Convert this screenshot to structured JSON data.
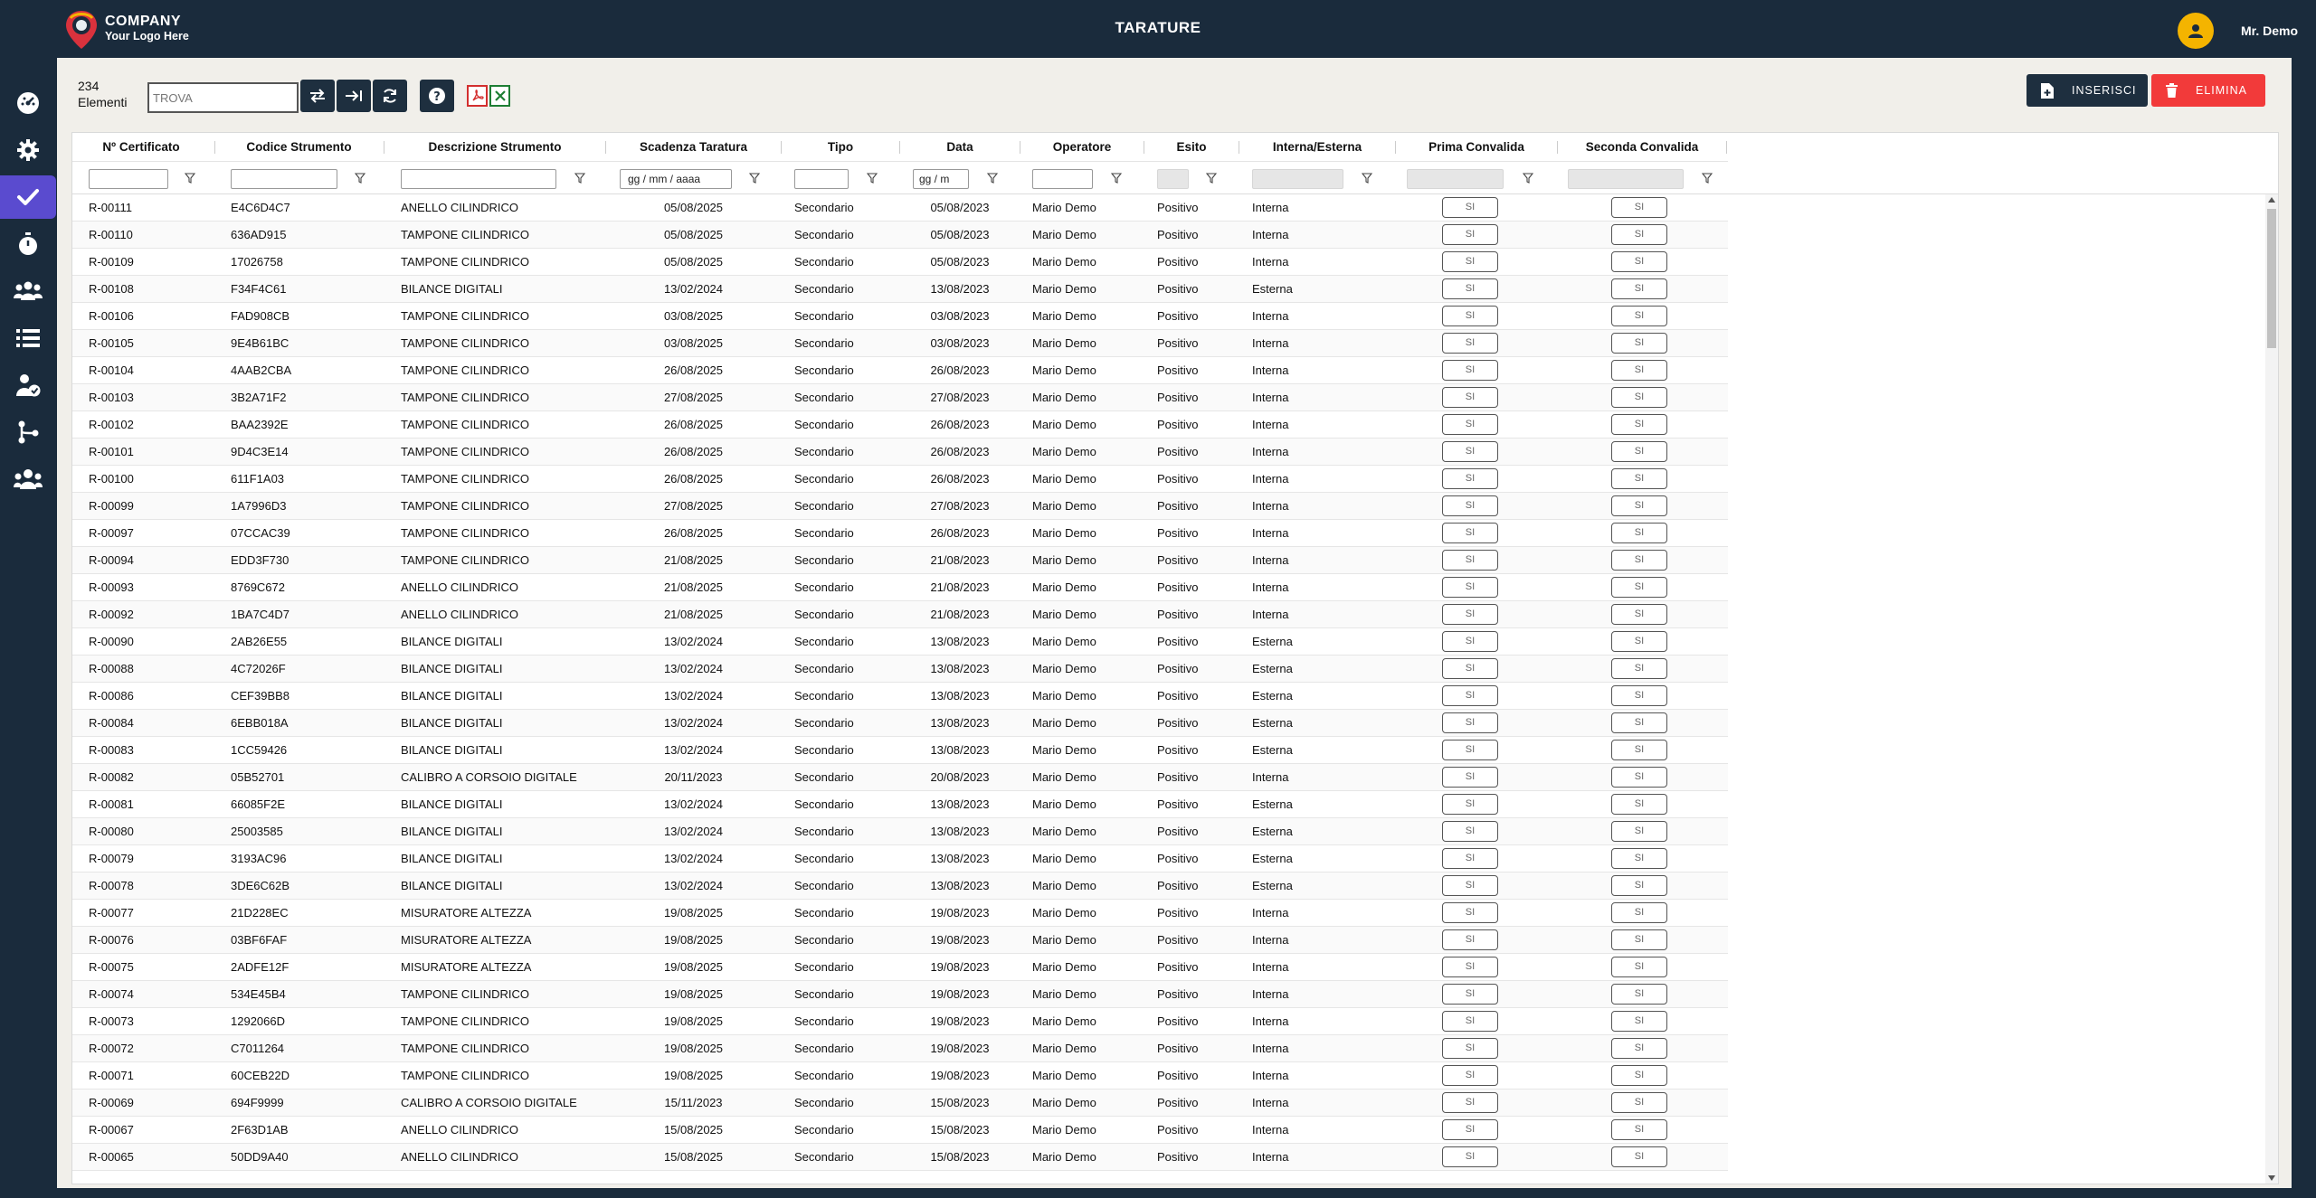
{
  "header": {
    "company": "COMPANY",
    "logo_tagline": "Your Logo Here",
    "title": "TARATURE",
    "user_name": "Mr. Demo"
  },
  "sidebar": {
    "items": [
      {
        "icon": "dashboard-icon"
      },
      {
        "icon": "gear-icon"
      },
      {
        "icon": "check-icon",
        "active": true
      },
      {
        "icon": "stopwatch-icon"
      },
      {
        "icon": "group-icon"
      },
      {
        "icon": "list-icon"
      },
      {
        "icon": "user-check-icon"
      },
      {
        "icon": "workflow-icon"
      },
      {
        "icon": "users-icon"
      }
    ]
  },
  "toolbar": {
    "count": "234",
    "count_label": "Elementi",
    "search_value": "TROVA",
    "insert_label": "INSERISCI",
    "delete_label": "ELIMINA"
  },
  "table": {
    "columns": [
      "Nº Certificato",
      "Codice Strumento",
      "Descrizione Strumento",
      "Scadenza Taratura",
      "Tipo",
      "Data",
      "Operatore",
      "Esito",
      "Interna/Esterna",
      "Prima Convalida",
      "Seconda Convalida"
    ],
    "date_placeholder_1": "gg / mm / aaaa",
    "date_placeholder_2": "gg / m",
    "rows": [
      [
        "R-00111",
        "E4C6D4C7",
        "ANELLO CILINDRICO",
        "05/08/2025",
        "Secondario",
        "05/08/2023",
        "Mario Demo",
        "Positivo",
        "Interna",
        "SI",
        "SI"
      ],
      [
        "R-00110",
        "636AD915",
        "TAMPONE CILINDRICO",
        "05/08/2025",
        "Secondario",
        "05/08/2023",
        "Mario Demo",
        "Positivo",
        "Interna",
        "SI",
        "SI"
      ],
      [
        "R-00109",
        "17026758",
        "TAMPONE CILINDRICO",
        "05/08/2025",
        "Secondario",
        "05/08/2023",
        "Mario Demo",
        "Positivo",
        "Interna",
        "SI",
        "SI"
      ],
      [
        "R-00108",
        "F34F4C61",
        "BILANCE DIGITALI",
        "13/02/2024",
        "Secondario",
        "13/08/2023",
        "Mario Demo",
        "Positivo",
        "Esterna",
        "SI",
        "SI"
      ],
      [
        "R-00106",
        "FAD908CB",
        "TAMPONE CILINDRICO",
        "03/08/2025",
        "Secondario",
        "03/08/2023",
        "Mario Demo",
        "Positivo",
        "Interna",
        "SI",
        "SI"
      ],
      [
        "R-00105",
        "9E4B61BC",
        "TAMPONE CILINDRICO",
        "03/08/2025",
        "Secondario",
        "03/08/2023",
        "Mario Demo",
        "Positivo",
        "Interna",
        "SI",
        "SI"
      ],
      [
        "R-00104",
        "4AAB2CBA",
        "TAMPONE CILINDRICO",
        "26/08/2025",
        "Secondario",
        "26/08/2023",
        "Mario Demo",
        "Positivo",
        "Interna",
        "SI",
        "SI"
      ],
      [
        "R-00103",
        "3B2A71F2",
        "TAMPONE CILINDRICO",
        "27/08/2025",
        "Secondario",
        "27/08/2023",
        "Mario Demo",
        "Positivo",
        "Interna",
        "SI",
        "SI"
      ],
      [
        "R-00102",
        "BAA2392E",
        "TAMPONE CILINDRICO",
        "26/08/2025",
        "Secondario",
        "26/08/2023",
        "Mario Demo",
        "Positivo",
        "Interna",
        "SI",
        "SI"
      ],
      [
        "R-00101",
        "9D4C3E14",
        "TAMPONE CILINDRICO",
        "26/08/2025",
        "Secondario",
        "26/08/2023",
        "Mario Demo",
        "Positivo",
        "Interna",
        "SI",
        "SI"
      ],
      [
        "R-00100",
        "611F1A03",
        "TAMPONE CILINDRICO",
        "26/08/2025",
        "Secondario",
        "26/08/2023",
        "Mario Demo",
        "Positivo",
        "Interna",
        "SI",
        "SI"
      ],
      [
        "R-00099",
        "1A7996D3",
        "TAMPONE CILINDRICO",
        "27/08/2025",
        "Secondario",
        "27/08/2023",
        "Mario Demo",
        "Positivo",
        "Interna",
        "SI",
        "SI"
      ],
      [
        "R-00097",
        "07CCAC39",
        "TAMPONE CILINDRICO",
        "26/08/2025",
        "Secondario",
        "26/08/2023",
        "Mario Demo",
        "Positivo",
        "Interna",
        "SI",
        "SI"
      ],
      [
        "R-00094",
        "EDD3F730",
        "TAMPONE CILINDRICO",
        "21/08/2025",
        "Secondario",
        "21/08/2023",
        "Mario Demo",
        "Positivo",
        "Interna",
        "SI",
        "SI"
      ],
      [
        "R-00093",
        "8769C672",
        "ANELLO CILINDRICO",
        "21/08/2025",
        "Secondario",
        "21/08/2023",
        "Mario Demo",
        "Positivo",
        "Interna",
        "SI",
        "SI"
      ],
      [
        "R-00092",
        "1BA7C4D7",
        "ANELLO CILINDRICO",
        "21/08/2025",
        "Secondario",
        "21/08/2023",
        "Mario Demo",
        "Positivo",
        "Interna",
        "SI",
        "SI"
      ],
      [
        "R-00090",
        "2AB26E55",
        "BILANCE DIGITALI",
        "13/02/2024",
        "Secondario",
        "13/08/2023",
        "Mario Demo",
        "Positivo",
        "Esterna",
        "SI",
        "SI"
      ],
      [
        "R-00088",
        "4C72026F",
        "BILANCE DIGITALI",
        "13/02/2024",
        "Secondario",
        "13/08/2023",
        "Mario Demo",
        "Positivo",
        "Esterna",
        "SI",
        "SI"
      ],
      [
        "R-00086",
        "CEF39BB8",
        "BILANCE DIGITALI",
        "13/02/2024",
        "Secondario",
        "13/08/2023",
        "Mario Demo",
        "Positivo",
        "Esterna",
        "SI",
        "SI"
      ],
      [
        "R-00084",
        "6EBB018A",
        "BILANCE DIGITALI",
        "13/02/2024",
        "Secondario",
        "13/08/2023",
        "Mario Demo",
        "Positivo",
        "Esterna",
        "SI",
        "SI"
      ],
      [
        "R-00083",
        "1CC59426",
        "BILANCE DIGITALI",
        "13/02/2024",
        "Secondario",
        "13/08/2023",
        "Mario Demo",
        "Positivo",
        "Esterna",
        "SI",
        "SI"
      ],
      [
        "R-00082",
        "05B52701",
        "CALIBRO A CORSOIO DIGITALE",
        "20/11/2023",
        "Secondario",
        "20/08/2023",
        "Mario Demo",
        "Positivo",
        "Interna",
        "SI",
        "SI"
      ],
      [
        "R-00081",
        "66085F2E",
        "BILANCE DIGITALI",
        "13/02/2024",
        "Secondario",
        "13/08/2023",
        "Mario Demo",
        "Positivo",
        "Esterna",
        "SI",
        "SI"
      ],
      [
        "R-00080",
        "25003585",
        "BILANCE DIGITALI",
        "13/02/2024",
        "Secondario",
        "13/08/2023",
        "Mario Demo",
        "Positivo",
        "Esterna",
        "SI",
        "SI"
      ],
      [
        "R-00079",
        "3193AC96",
        "BILANCE DIGITALI",
        "13/02/2024",
        "Secondario",
        "13/08/2023",
        "Mario Demo",
        "Positivo",
        "Esterna",
        "SI",
        "SI"
      ],
      [
        "R-00078",
        "3DE6C62B",
        "BILANCE DIGITALI",
        "13/02/2024",
        "Secondario",
        "13/08/2023",
        "Mario Demo",
        "Positivo",
        "Esterna",
        "SI",
        "SI"
      ],
      [
        "R-00077",
        "21D228EC",
        "MISURATORE ALTEZZA",
        "19/08/2025",
        "Secondario",
        "19/08/2023",
        "Mario Demo",
        "Positivo",
        "Interna",
        "SI",
        "SI"
      ],
      [
        "R-00076",
        "03BF6FAF",
        "MISURATORE ALTEZZA",
        "19/08/2025",
        "Secondario",
        "19/08/2023",
        "Mario Demo",
        "Positivo",
        "Interna",
        "SI",
        "SI"
      ],
      [
        "R-00075",
        "2ADFE12F",
        "MISURATORE ALTEZZA",
        "19/08/2025",
        "Secondario",
        "19/08/2023",
        "Mario Demo",
        "Positivo",
        "Interna",
        "SI",
        "SI"
      ],
      [
        "R-00074",
        "534E45B4",
        "TAMPONE CILINDRICO",
        "19/08/2025",
        "Secondario",
        "19/08/2023",
        "Mario Demo",
        "Positivo",
        "Interna",
        "SI",
        "SI"
      ],
      [
        "R-00073",
        "1292066D",
        "TAMPONE CILINDRICO",
        "19/08/2025",
        "Secondario",
        "19/08/2023",
        "Mario Demo",
        "Positivo",
        "Interna",
        "SI",
        "SI"
      ],
      [
        "R-00072",
        "C7011264",
        "TAMPONE CILINDRICO",
        "19/08/2025",
        "Secondario",
        "19/08/2023",
        "Mario Demo",
        "Positivo",
        "Interna",
        "SI",
        "SI"
      ],
      [
        "R-00071",
        "60CEB22D",
        "TAMPONE CILINDRICO",
        "19/08/2025",
        "Secondario",
        "19/08/2023",
        "Mario Demo",
        "Positivo",
        "Interna",
        "SI",
        "SI"
      ],
      [
        "R-00069",
        "694F9999",
        "CALIBRO A CORSOIO DIGITALE",
        "15/11/2023",
        "Secondario",
        "15/08/2023",
        "Mario Demo",
        "Positivo",
        "Interna",
        "SI",
        "SI"
      ],
      [
        "R-00067",
        "2F63D1AB",
        "ANELLO CILINDRICO",
        "15/08/2025",
        "Secondario",
        "15/08/2023",
        "Mario Demo",
        "Positivo",
        "Interna",
        "SI",
        "SI"
      ],
      [
        "R-00065",
        "50DD9A40",
        "ANELLO CILINDRICO",
        "15/08/2025",
        "Secondario",
        "15/08/2023",
        "Mario Demo",
        "Positivo",
        "Interna",
        "SI",
        "SI"
      ]
    ]
  },
  "colors": {
    "sidebar_bg": "#1a2b3c",
    "active_item": "#5a4bcf",
    "avatar": "#f4b400",
    "delete_button": "#f23a3a",
    "dark_button": "#1e2f3f"
  }
}
